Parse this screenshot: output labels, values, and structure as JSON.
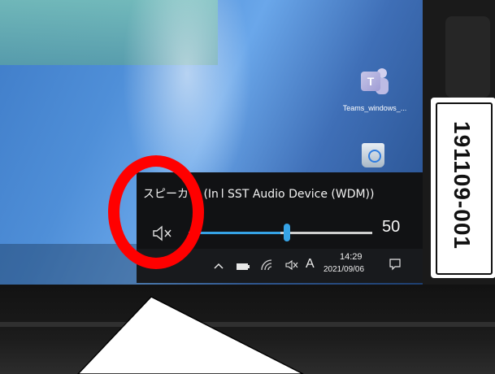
{
  "desktop": {
    "icons": [
      {
        "label": "Teams_windows_...",
        "icon": "teams-icon"
      },
      {
        "label": "",
        "icon": "recycle-bin-icon"
      }
    ]
  },
  "volume_flyout": {
    "device_title": "スピーカー (In l SST Audio Device (WDM))",
    "mute_icon": "speaker-muted-icon",
    "volume_value": "50",
    "volume_level": 0.5,
    "accent_color": "#36a3e6"
  },
  "taskbar": {
    "ime_label": "A",
    "time": "14:29",
    "date": "2021/09/06",
    "tray_icons": [
      "chevron-up-icon",
      "battery-icon",
      "wifi-icon",
      "speaker-muted-icon",
      "notification-icon"
    ]
  },
  "asset_tag": {
    "text": "191109-001"
  },
  "annotation": {
    "ring_color": "#ff0000"
  }
}
